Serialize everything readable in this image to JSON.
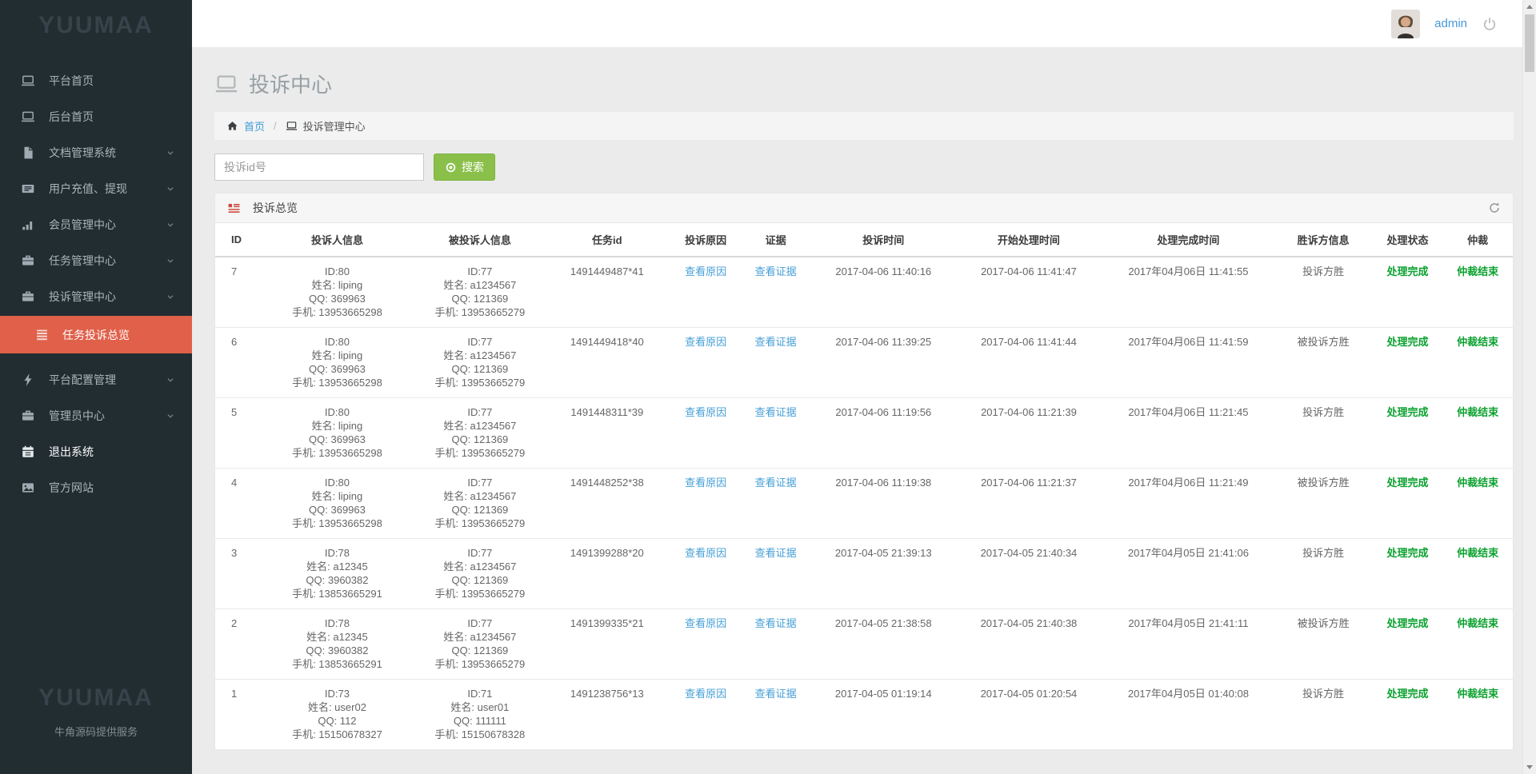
{
  "app": {
    "brand": "YUUMAA",
    "brand_tagline": "牛角源码提供服务"
  },
  "header": {
    "username": "admin"
  },
  "colors": {
    "sidebar_bg": "#222d32",
    "active_item_red": "#e0604a",
    "link_blue": "#459fd6",
    "success_green": "#0aa12e",
    "button_green": "#8ac04a",
    "panel_icon_red": "#cd4a3e"
  },
  "sidebar": {
    "items": [
      {
        "label": "平台首页",
        "icon": "laptop-icon",
        "expandable": false
      },
      {
        "label": "后台首页",
        "icon": "laptop-icon",
        "expandable": false
      },
      {
        "label": "文档管理系统",
        "icon": "file-icon",
        "expandable": true
      },
      {
        "label": "用户充值、提现",
        "icon": "newspaper-icon",
        "expandable": true
      },
      {
        "label": "会员管理中心",
        "icon": "chart-icon",
        "expandable": true
      },
      {
        "label": "任务管理中心",
        "icon": "briefcase-icon",
        "expandable": true
      },
      {
        "label": "投诉管理中心",
        "icon": "briefcase-icon",
        "expandable": true
      },
      {
        "label": "平台配置管理",
        "icon": "lightning-icon",
        "expandable": true
      },
      {
        "label": "管理员中心",
        "icon": "briefcase-icon",
        "expandable": true
      },
      {
        "label": "退出系统",
        "icon": "calendar-icon",
        "expandable": false
      },
      {
        "label": "官方网站",
        "icon": "image-icon",
        "expandable": false
      }
    ],
    "subitem": {
      "label": "任务投诉总览",
      "icon": "list-icon",
      "active": true
    }
  },
  "main": {
    "page_title": "投诉中心",
    "breadcrumb": {
      "home": "首页",
      "separator": "/",
      "current": "投诉管理中心"
    },
    "search": {
      "placeholder": "投诉id号",
      "button_label": "搜索"
    },
    "panel": {
      "title": "投诉总览"
    },
    "table": {
      "headers": [
        "ID",
        "投诉人信息",
        "被投诉人信息",
        "任务id",
        "投诉原因",
        "证据",
        "投诉时间",
        "开始处理时间",
        "处理完成时间",
        "胜诉方信息",
        "处理状态",
        "仲裁"
      ],
      "reason_link_label": "查看原因",
      "evidence_link_label": "查看证据",
      "status_label": "处理完成",
      "arbitration_label": "仲裁结束",
      "rows": [
        {
          "id": "7",
          "complainant": {
            "id": "ID:80",
            "name": "姓名: liping",
            "qq": "QQ: 369963",
            "phone": "手机: 13953665298"
          },
          "respondent": {
            "id": "ID:77",
            "name": "姓名: a1234567",
            "qq": "QQ: 121369",
            "phone": "手机: 13953665279"
          },
          "task_id": "1491449487*41",
          "complaint_time": "2017-04-06 11:40:16",
          "start_time": "2017-04-06 11:41:47",
          "finish_time": "2017年04月06日 11:41:55",
          "winner": "投诉方胜"
        },
        {
          "id": "6",
          "complainant": {
            "id": "ID:80",
            "name": "姓名: liping",
            "qq": "QQ: 369963",
            "phone": "手机: 13953665298"
          },
          "respondent": {
            "id": "ID:77",
            "name": "姓名: a1234567",
            "qq": "QQ: 121369",
            "phone": "手机: 13953665279"
          },
          "task_id": "1491449418*40",
          "complaint_time": "2017-04-06 11:39:25",
          "start_time": "2017-04-06 11:41:44",
          "finish_time": "2017年04月06日 11:41:59",
          "winner": "被投诉方胜"
        },
        {
          "id": "5",
          "complainant": {
            "id": "ID:80",
            "name": "姓名: liping",
            "qq": "QQ: 369963",
            "phone": "手机: 13953665298"
          },
          "respondent": {
            "id": "ID:77",
            "name": "姓名: a1234567",
            "qq": "QQ: 121369",
            "phone": "手机: 13953665279"
          },
          "task_id": "1491448311*39",
          "complaint_time": "2017-04-06 11:19:56",
          "start_time": "2017-04-06 11:21:39",
          "finish_time": "2017年04月06日 11:21:45",
          "winner": "投诉方胜"
        },
        {
          "id": "4",
          "complainant": {
            "id": "ID:80",
            "name": "姓名: liping",
            "qq": "QQ: 369963",
            "phone": "手机: 13953665298"
          },
          "respondent": {
            "id": "ID:77",
            "name": "姓名: a1234567",
            "qq": "QQ: 121369",
            "phone": "手机: 13953665279"
          },
          "task_id": "1491448252*38",
          "complaint_time": "2017-04-06 11:19:38",
          "start_time": "2017-04-06 11:21:37",
          "finish_time": "2017年04月06日 11:21:49",
          "winner": "被投诉方胜"
        },
        {
          "id": "3",
          "complainant": {
            "id": "ID:78",
            "name": "姓名: a12345",
            "qq": "QQ: 3960382",
            "phone": "手机: 13853665291"
          },
          "respondent": {
            "id": "ID:77",
            "name": "姓名: a1234567",
            "qq": "QQ: 121369",
            "phone": "手机: 13953665279"
          },
          "task_id": "1491399288*20",
          "complaint_time": "2017-04-05 21:39:13",
          "start_time": "2017-04-05 21:40:34",
          "finish_time": "2017年04月05日 21:41:06",
          "winner": "投诉方胜"
        },
        {
          "id": "2",
          "complainant": {
            "id": "ID:78",
            "name": "姓名: a12345",
            "qq": "QQ: 3960382",
            "phone": "手机: 13853665291"
          },
          "respondent": {
            "id": "ID:77",
            "name": "姓名: a1234567",
            "qq": "QQ: 121369",
            "phone": "手机: 13953665279"
          },
          "task_id": "1491399335*21",
          "complaint_time": "2017-04-05 21:38:58",
          "start_time": "2017-04-05 21:40:38",
          "finish_time": "2017年04月05日 21:41:11",
          "winner": "被投诉方胜"
        },
        {
          "id": "1",
          "complainant": {
            "id": "ID:73",
            "name": "姓名: user02",
            "qq": "QQ: 112",
            "phone": "手机: 15150678327"
          },
          "respondent": {
            "id": "ID:71",
            "name": "姓名: user01",
            "qq": "QQ: 111111",
            "phone": "手机: 15150678328"
          },
          "task_id": "1491238756*13",
          "complaint_time": "2017-04-05 01:19:14",
          "start_time": "2017-04-05 01:20:54",
          "finish_time": "2017年04月05日 01:40:08",
          "winner": "投诉方胜"
        }
      ]
    }
  }
}
